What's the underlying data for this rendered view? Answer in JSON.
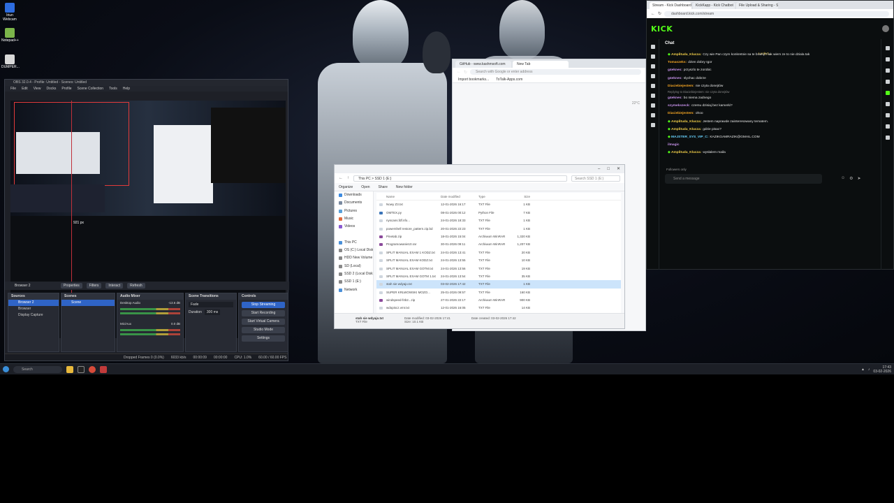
{
  "desktop": {
    "icons": [
      {
        "label": "Iriun Webcam",
        "color": "#2d6cdf"
      },
      {
        "label": "Notepad++",
        "color": "#7bb44a"
      },
      {
        "label": "DUMPER...",
        "color": "#d8d8d8"
      }
    ]
  },
  "obs": {
    "title": "OBS 32.0.4 - Profile: Untitled - Scenes: Untitled",
    "menu": [
      "File",
      "Edit",
      "View",
      "Docks",
      "Profile",
      "Scene Collection",
      "Tools",
      "Help"
    ],
    "measure_label": "921 px",
    "toolbar": {
      "source_name": "Browser 2",
      "properties": "Properties",
      "filters": "Filters",
      "interact": "Interact",
      "refresh": "Refresh"
    },
    "sources": {
      "title": "Sources",
      "items": [
        "Browser 2",
        "Browser",
        "Display Capture"
      ]
    },
    "scenes": {
      "title": "Scenes",
      "items": [
        "Scene"
      ]
    },
    "mixer": {
      "title": "Audio Mixer",
      "tracks": [
        {
          "name": "Desktop Audio",
          "level": "-13.6 dB"
        },
        {
          "name": "Mic/Aux",
          "level": "0.0 dB"
        }
      ]
    },
    "transitions": {
      "title": "Scene Transitions",
      "type": "Fade",
      "duration_label": "Duration",
      "duration": "300 ms"
    },
    "controls": {
      "title": "Controls",
      "buttons": [
        "Stop Streaming",
        "Start Recording",
        "Start Virtual Camera",
        "Studio Mode",
        "Settings"
      ]
    },
    "status": {
      "dropped": "Dropped Frames 0 (0.0%)",
      "bitrate": "6033 kb/s",
      "live": "00:00:09",
      "rec": "00:00:00",
      "cpu": "CPU: 1.0%",
      "fps": "60.00 / 60.00 FPS"
    }
  },
  "chrome": {
    "tabs": [
      "GitHub - www.kashmsoft.com",
      "New Tab"
    ],
    "omnibox_placeholder": "Search with Google or enter address",
    "bookmarks": [
      "Import bookmarks...",
      "ToTalk-Apps.com"
    ],
    "weather": "22°C"
  },
  "explorer": {
    "path": "This PC  >  SSD 1 (E:)",
    "search_placeholder": "Search SSD 1 (E:)",
    "commands": [
      "Organize",
      "Open",
      "Share",
      "New folder"
    ],
    "sidebar": [
      {
        "label": "Downloads",
        "color": "#3d8be0"
      },
      {
        "label": "Documents",
        "color": "#7a8aa0"
      },
      {
        "label": "Pictures",
        "color": "#5aa0d8"
      },
      {
        "label": "Music",
        "color": "#e06a3d"
      },
      {
        "label": "Videos",
        "color": "#8a5ad0"
      },
      {
        "label": "",
        "color": "transparent"
      },
      {
        "label": "This PC",
        "color": "#4a90d9"
      },
      {
        "label": "OS (C:) Local Disk",
        "color": "#888"
      },
      {
        "label": "HDD New Volume",
        "color": "#888"
      },
      {
        "label": "SD (Local)",
        "color": "#888"
      },
      {
        "label": "SSD 2 (Local Disk)",
        "color": "#888"
      },
      {
        "label": "SSD 1 (E:)",
        "color": "#888"
      },
      {
        "label": "Network",
        "color": "#4a90d9"
      }
    ],
    "columns": [
      "Name",
      "Date modified",
      "Type",
      "Size"
    ],
    "rows": [
      {
        "name": "Nowy Z3.txt",
        "date": "12-01-2026 16:17",
        "type": "TXT File",
        "size": "1 KB",
        "color": "#cfd6de"
      },
      {
        "name": "OMTEX.py",
        "date": "08-01-2026 00:12",
        "type": "Python File",
        "size": "7 KB",
        "color": "#3b74b8"
      },
      {
        "name": "nyscans.fdf.nfo...",
        "date": "24-01-2026 18:33",
        "type": "TXT File",
        "size": "1 KB",
        "color": "#cfd6de"
      },
      {
        "name": "powershell restore_pattern.zip.bd",
        "date": "20-01-2026 22:23",
        "type": "TXT File",
        "size": "1 KB",
        "color": "#cfd6de"
      },
      {
        "name": "Pinetab.zip",
        "date": "18-01-2026 15:04",
        "type": "Archiwum WinRAR",
        "size": "1,320 KB",
        "color": "#8b4a9b"
      },
      {
        "name": "Programowanie10.rar",
        "date": "30-01-2026 09:11",
        "type": "Archiwum WinRAR",
        "size": "1,207 KB",
        "color": "#8b4a9b"
      },
      {
        "name": "SPLIT MANUAL EXAM 1 KODZ.txt",
        "date": "24-01-2026 13:41",
        "type": "TXT File",
        "size": "20 KB",
        "color": "#cfd6de"
      },
      {
        "name": "SPLIT MANUAL EXAM KODZ.txt",
        "date": "24-01-2026 13:55",
        "type": "TXT File",
        "size": "10 KB",
        "color": "#cfd6de"
      },
      {
        "name": "SPLIT MANUAL EXAM GOTM.txt",
        "date": "24-01-2026 13:56",
        "type": "TXT File",
        "size": "19 KB",
        "color": "#cfd6de"
      },
      {
        "name": "SPLIT MANUAL EXAM GOTM 1.txt",
        "date": "24-01-2026 13:54",
        "type": "TXT File",
        "size": "35 KB",
        "color": "#cfd6de"
      },
      {
        "name": "stah sie wdyajo.txt",
        "date": "03-02-2026 17:42",
        "type": "TXT File",
        "size": "1 KB",
        "color": "#cfd6de"
      },
      {
        "name": "SUPER KRLWOWSKI MOZO...",
        "date": "25-01-2026 09:57",
        "type": "TXT File",
        "size": "160 KB",
        "color": "#cfd6de"
      },
      {
        "name": "windspeed-f4b2...zip",
        "date": "27-01-2026 22:17",
        "type": "Archiwum WinRAR",
        "size": "900 KB",
        "color": "#8b4a9b"
      },
      {
        "name": "wdopiscz.vmr.txt",
        "date": "12-01-2026 16:05",
        "type": "TXT File",
        "size": "14 KB",
        "color": "#cfd6de"
      }
    ],
    "selected_index": 10,
    "details": {
      "name": "stah sie wdyajo.txt",
      "type": "TXT File",
      "modified_label": "Date modified:",
      "modified": "03-02-2026 17:41",
      "size_label": "Size:",
      "size": "10.1 KB",
      "created_label": "Date created:",
      "created": "03-02-2026 17:42"
    }
  },
  "kick": {
    "tabs": [
      "Stream - Kick Dashboard",
      "KickKapp - Kick Chatbot",
      "File Upload & Sharing - Sen..."
    ],
    "url": "dashboard.kick.com/stream",
    "logo": "KICK",
    "chat_title": "Chat",
    "pinned": "Lucky1...",
    "messages": [
      {
        "user": "Amplituda_Klucza:",
        "text": "Czy wie Pan czym konkretnie sa te bramy? tak wiem ze to nie dziala tak",
        "color": "#f5d24a",
        "badge": true
      },
      {
        "user": "Tomaszeks:",
        "text": "dzien dobry Igor",
        "color": "#f5a623",
        "badge": false
      },
      {
        "user": "g4eknes:",
        "text": "przyszlo te zorobic",
        "color": "#c792ea",
        "badge": false
      },
      {
        "user": "g4eknes:",
        "text": "slychac dobrze",
        "color": "#c792ea",
        "badge": false
      },
      {
        "user": "Diaciebiejestem:",
        "text": "nie czyta donejtów",
        "color": "#f5a623",
        "badge": false
      },
      {
        "user": "",
        "text": "Replying to Diaciebiejestem: nie czyta donejtów",
        "color": "#888",
        "badge": false,
        "small": true
      },
      {
        "user": "g4eknes:",
        "text": "bo niema zadnego",
        "color": "#c792ea",
        "badge": false
      },
      {
        "user": "szymekszeck:",
        "text": "czemu dzisiaj bez kamerki?",
        "color": "#c792ea",
        "badge": false
      },
      {
        "user": "Diaciebiejestem:",
        "text": "ohoo",
        "color": "#f5a623",
        "badge": false
      },
      {
        "user": "Amplituda_Klucza:",
        "text": "Jestem naprawde zainteresowany tematem.",
        "color": "#f5d24a",
        "badge": true
      },
      {
        "user": "Amplituda_Klucza:",
        "text": "gdzie pisac?",
        "color": "#f5d24a",
        "badge": true
      },
      {
        "user": "MAJSTER_SYS_VIP_C:",
        "text": "KAZIKGAMRAZIK@GMAIL.COM",
        "color": "#6ad3ff",
        "badge": true
      },
      {
        "user": "ilmagic",
        "text": "",
        "color": "#c792ea",
        "badge": false
      },
      {
        "user": "Amplituda_Klucza:",
        "text": "wyslalem maila",
        "color": "#f5d24a",
        "badge": true
      }
    ],
    "followers_only": "Followers only",
    "input_placeholder": "Send a message",
    "accent": "#53fc18"
  },
  "taskbar": {
    "search_placeholder": "Search",
    "time": "17:43",
    "date": "03-02-2026"
  }
}
